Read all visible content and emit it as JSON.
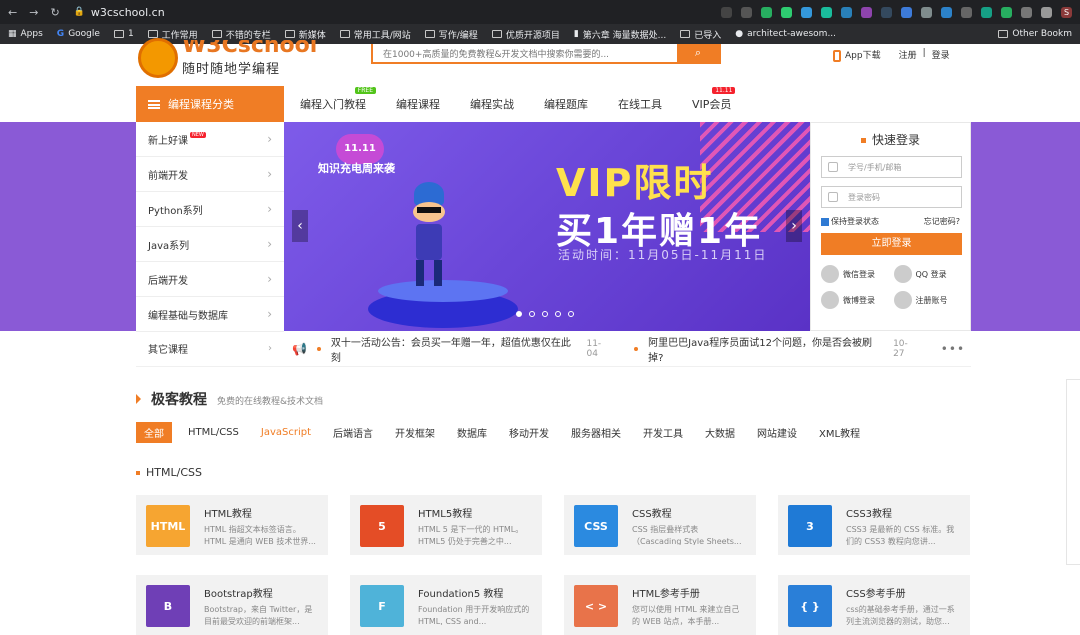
{
  "browser": {
    "url": "w3cschool.cn",
    "bookmarks": [
      "Apps",
      "Google",
      "1",
      "工作常用",
      "不错的专栏",
      "新媒体",
      "常用工具/网站",
      "写作/编程",
      "优质开源项目",
      "第六章 海量数据处...",
      "已导入",
      "architect-awesom..."
    ],
    "other_bookmarks": "Other Bookm",
    "profile_initial": "S"
  },
  "site": {
    "brand": "W3Cschool",
    "slogan": "随时随地学编程",
    "search_placeholder": "在1000+高质量的免费教程&开发文档中搜索你需要的...",
    "app_download": "App下载",
    "register": "注册",
    "login_link": "登录",
    "divider": "|"
  },
  "nav": {
    "category_button": "编程课程分类",
    "items": [
      "编程入门教程",
      "编程课程",
      "编程实战",
      "编程题库",
      "在线工具",
      "VIP会员"
    ],
    "badge_free": "FREE",
    "badge_sale": "11.11"
  },
  "sidebar": {
    "items": [
      "新上好课",
      "前端开发",
      "Python系列",
      "Java系列",
      "后端开发",
      "编程基础与数据库",
      "其它课程"
    ],
    "hot_badge": "NEW"
  },
  "banner": {
    "cloud_text": "11.11",
    "promo": "知识充电周来袭",
    "title_line1": "VIP限时",
    "title_line2": "买1年赠1年",
    "date": "活动时间：11月05日-11月11日",
    "slide_count": 5,
    "active_slide": 1
  },
  "login": {
    "title": "快速登录",
    "account_placeholder": "学号/手机/邮箱",
    "password_placeholder": "登录密码",
    "remember": "保持登录状态",
    "forgot": "忘记密码?",
    "submit": "立即登录",
    "social": [
      "微信登录",
      "QQ 登录",
      "微博登录",
      "注册账号"
    ]
  },
  "news": [
    {
      "text": "双十一活动公告：会员买一年赠一年，超值优惠仅在此刻",
      "date": "11-04"
    },
    {
      "text": "阿里巴巴Java程序员面试12个问题，你是否会被刷掉?",
      "date": "10-27"
    }
  ],
  "section": {
    "title": "极客教程",
    "subtitle": "免费的在线教程&技术文档",
    "filters": [
      "全部",
      "HTML/CSS",
      "JavaScript",
      "后端语言",
      "开发框架",
      "数据库",
      "移动开发",
      "服务器相关",
      "开发工具",
      "大数据",
      "网站建设",
      "XML教程"
    ],
    "group_title": "HTML/CSS"
  },
  "cards": [
    {
      "title": "HTML教程",
      "desc": "HTML 指超文本标签语言。HTML 是通向 WEB 技术世界...",
      "logo": "HTML",
      "color": "#f6a531"
    },
    {
      "title": "HTML5教程",
      "desc": "HTML 5 是下一代的 HTML。HTML5 仍处于完善之中...",
      "logo": "5",
      "color": "#e44d26"
    },
    {
      "title": "CSS教程",
      "desc": "CSS 指层叠样式表（Cascading Style Sheets...",
      "logo": "CSS",
      "color": "#2b8ae0"
    },
    {
      "title": "CSS3教程",
      "desc": "CSS3 是最新的 CSS 标准。我们的 CSS3 教程向您讲...",
      "logo": "3",
      "color": "#1f7ad6"
    },
    {
      "title": "Bootstrap教程",
      "desc": "Bootstrap，来自 Twitter，是目前最受欢迎的前端框架...",
      "logo": "B",
      "color": "#6f3fb6"
    },
    {
      "title": "Foundation5 教程",
      "desc": "Foundation 用于开发响应式的 HTML, CSS and...",
      "logo": "F",
      "color": "#4fb3d9"
    },
    {
      "title": "HTML参考手册",
      "desc": "您可以使用 HTML 来建立自己的 WEB 站点，本手册...",
      "logo": "< >",
      "color": "#e8734a"
    },
    {
      "title": "CSS参考手册",
      "desc": "css的基础参考手册，通过一系列主流浏览器的测试，助您...",
      "logo": "{ }",
      "color": "#2a7fd8"
    }
  ]
}
